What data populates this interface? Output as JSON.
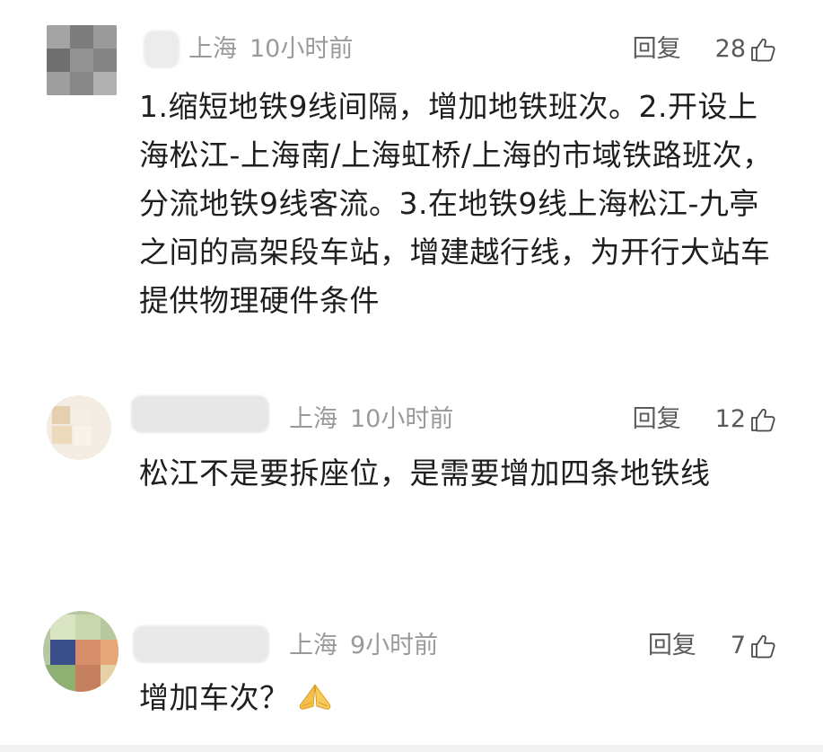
{
  "comments": [
    {
      "location": "上海",
      "time": "10小时前",
      "reply_label": "回复",
      "likes": "28",
      "text": "1.缩短地铁9线间隔，增加地铁班次。2.开设上海松江-上海南/上海虹桥/上海的市域铁路班次，分流地铁9线客流。3.在地铁9线上海松江-九亭之间的高架段车站，增建越行线，为开行大站车提供物理硬件条件"
    },
    {
      "location": "上海",
      "time": "10小时前",
      "reply_label": "回复",
      "likes": "12",
      "text": "松江不是要拆座位，是需要增加四条地铁线"
    },
    {
      "location": "上海",
      "time": "9小时前",
      "reply_label": "回复",
      "likes": "7",
      "text": "增加车次？"
    }
  ],
  "icons": {
    "like": "thumbs-up-icon",
    "emoji": "praying-hands-emoji"
  },
  "colors": {
    "meta_text": "#9a9a9a",
    "action_text": "#5a5a5a",
    "body_text": "#1e1e1e"
  }
}
